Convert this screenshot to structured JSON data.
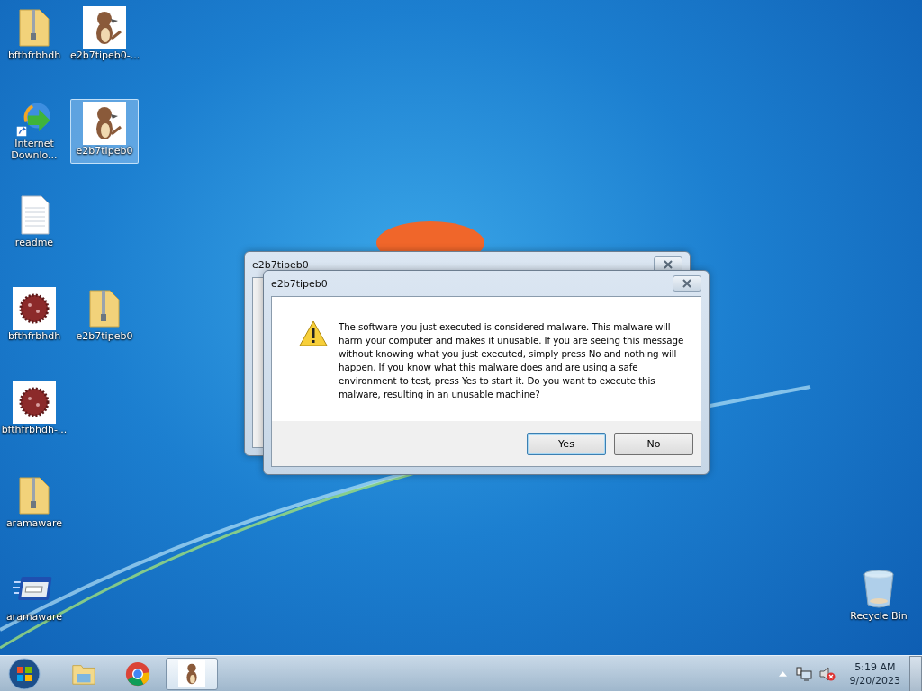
{
  "desktop": {
    "columns": [
      [
        {
          "label": "bfthfrbhdh",
          "kind": "zip-folder",
          "selected": false
        },
        {
          "label": "Internet Downlo...",
          "kind": "downloader",
          "selected": false
        },
        {
          "label": "readme",
          "kind": "text-file",
          "selected": false
        },
        {
          "label": "bfthfrbhdh",
          "kind": "virus-image",
          "selected": false
        },
        {
          "label": "bfthfrbhdh-...",
          "kind": "virus-image",
          "selected": false
        },
        {
          "label": "aramaware",
          "kind": "zip-folder",
          "selected": false
        },
        {
          "label": "aramaware",
          "kind": "app-window",
          "selected": false
        }
      ],
      [
        {
          "label": "e2b7tipeb0-...",
          "kind": "creature-image",
          "selected": false
        },
        {
          "label": "e2b7tipeb0",
          "kind": "creature-image",
          "selected": true
        },
        {
          "label": "e2b7tipeb0",
          "kind": "zip-folder",
          "selected": false
        }
      ]
    ],
    "recycle_bin": {
      "label": "Recycle Bin"
    }
  },
  "back_dialog": {
    "title": "e2b7tipeb0"
  },
  "dialog": {
    "title": "e2b7tipeb0",
    "message": "The software you just executed is considered malware. This malware will harm your computer and makes it unusable. If you are seeing this message without knowing what you just executed, simply press No and nothing will happen. If you know what this malware does and are using a safe environment to test, press Yes to start it. Do you want to execute this malware, resulting in an unusable machine?",
    "buttons": [
      {
        "label": "Yes",
        "selected": true
      },
      {
        "label": "No",
        "selected": false
      }
    ]
  },
  "taskbar": {
    "items": [
      {
        "kind": "explorer",
        "selected": false
      },
      {
        "kind": "chrome",
        "selected": false
      },
      {
        "kind": "creature",
        "selected": true
      }
    ],
    "clock": {
      "time": "5:19 AM",
      "date": "9/20/2023"
    }
  }
}
